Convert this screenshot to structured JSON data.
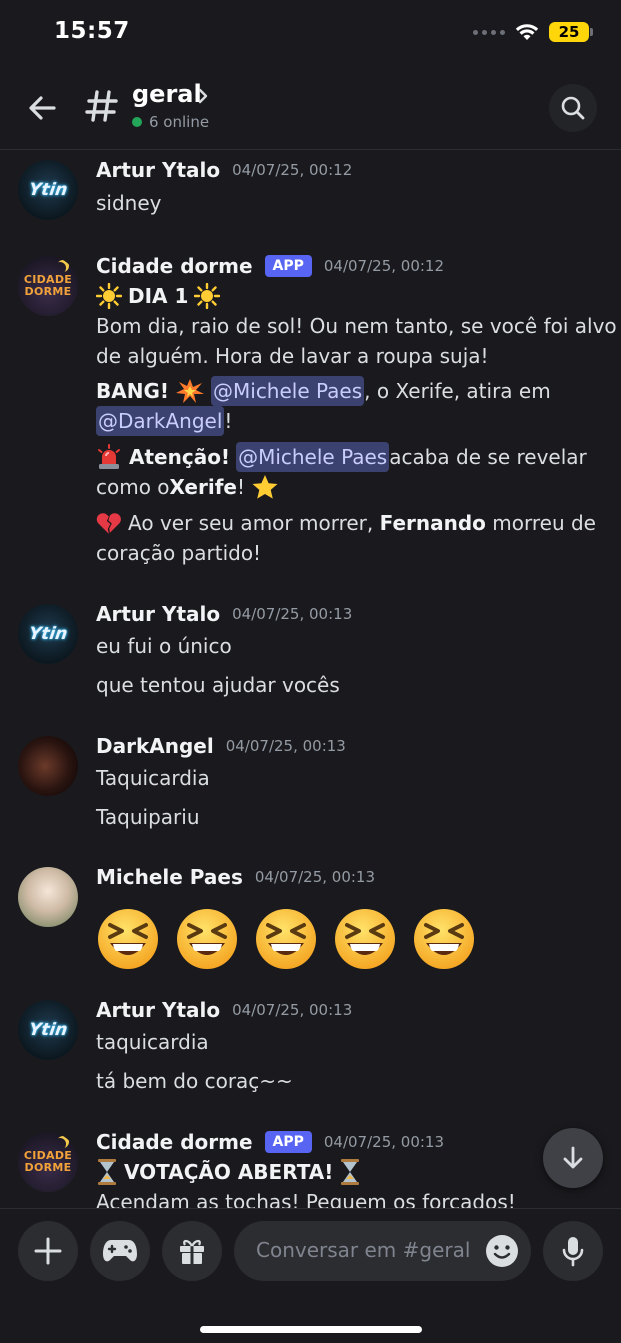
{
  "status_bar": {
    "time": "15:57",
    "battery": "25"
  },
  "header": {
    "channel_name": "geral",
    "online_count": "6 online"
  },
  "messages": [
    {
      "author": "Artur Ytalo",
      "timestamp": "04/07/25, 00:12",
      "lines": [
        "sidney"
      ]
    },
    {
      "author": "Cidade dorme",
      "tag": "APP",
      "timestamp": "04/07/25, 00:12",
      "title": "DIA 1",
      "line1": "Bom dia, raio de sol! Ou nem tanto, se você foi alvo",
      "line2": "de alguém. Hora de lavar a roupa suja!",
      "bang_prefix": "BANG!",
      "mention_michele": "@Michele Paes",
      "bang_suffix": ", o Xerife, atira em",
      "mention_darkangel": "@DarkAngel",
      "bang_end": "!",
      "attention_label": "Atenção!",
      "attention_suffix": " acaba de se revelar",
      "attention_line2_prefix": "como o ",
      "attention_role": "Xerife",
      "attention_line2_end": "!",
      "heart_line1_prefix": " Ao ver seu amor morrer, ",
      "heart_name": "Fernando",
      "heart_line1_suffix": " morreu de",
      "heart_line2": "coração partido!"
    },
    {
      "author": "Artur Ytalo",
      "timestamp": "04/07/25, 00:13",
      "lines": [
        "eu fui o único",
        "que tentou ajudar vocês"
      ]
    },
    {
      "author": "DarkAngel",
      "timestamp": "04/07/25, 00:13",
      "lines": [
        "Taquicardia",
        "Taquipariu"
      ]
    },
    {
      "author": "Michele Paes",
      "timestamp": "04/07/25, 00:13",
      "emoji_count": 5,
      "emoji": "grinning-squinting-face"
    },
    {
      "author": "Artur Ytalo",
      "timestamp": "04/07/25, 00:13",
      "lines": [
        "taquicardia",
        "tá bem do coraç~~"
      ]
    },
    {
      "author": "Cidade dorme",
      "tag": "APP",
      "timestamp": "04/07/25, 00:13",
      "title": "VOTAÇÃO ABERTA!",
      "line1": "Acendam as tochas! Peguem os forcados!"
    }
  ],
  "avatars": {
    "artur_text": "Ytin",
    "cidade_text_1": "CIDADE",
    "cidade_text_2": "DORME"
  },
  "composer": {
    "placeholder": "Conversar em #geral"
  },
  "colors": {
    "accent": "#5865f2",
    "online": "#23a55a",
    "background": "#1a1a1e",
    "mention_bg": "#3c4270"
  },
  "icons": [
    "back-arrow-icon",
    "hash-icon",
    "chevron-right-icon",
    "search-icon",
    "plus-icon",
    "gamepad-icon",
    "gift-icon",
    "smile-icon",
    "microphone-icon",
    "arrow-down-icon",
    "wifi-icon"
  ]
}
